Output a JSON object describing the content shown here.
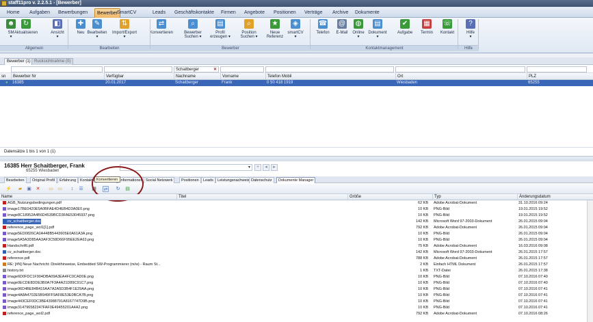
{
  "window": {
    "title": "staff11pro v. 2.2.5.1 - [Bewerber]"
  },
  "menu": {
    "tabs": [
      "Home",
      "Aufgaben",
      "Bewerbungen",
      "Bewerber",
      "SmartCV",
      "Leads",
      "Geschäftskontakte",
      "Firmen",
      "Angebote",
      "Positionen",
      "Verträge",
      "Archive",
      "Dokumente"
    ],
    "active": "Bewerber"
  },
  "ribbon": {
    "buttons": [
      {
        "label": "SM\n▾",
        "icon": "person-icon",
        "color": "#3c8a3c"
      },
      {
        "label": "Aktualisieren",
        "icon": "refresh-icon",
        "color": "#3a9a3a"
      },
      {
        "label": "Ansicht\n▾",
        "icon": "view-icon",
        "color": "#5a6fb4"
      },
      {
        "label": "Neu",
        "icon": "new-person-icon",
        "color": "#4c8fd0"
      },
      {
        "label": "Bearbeiten\n▾",
        "icon": "edit-person-icon",
        "color": "#4c8fd0"
      },
      {
        "label": "Import/Export\n▾",
        "icon": "import-export-icon",
        "color": "#e0a22c"
      },
      {
        "label": "Konvertieren",
        "icon": "convert-icon",
        "color": "#4c8fd0"
      },
      {
        "label": "Bewerber\nSuchen ▾",
        "icon": "search-person-icon",
        "color": "#4c8fd0"
      },
      {
        "label": "Profil\nerzeugen ▾",
        "icon": "profile-icon",
        "color": "#4c8fd0"
      },
      {
        "label": "Position\nSuchen ▾",
        "icon": "search-position-icon",
        "color": "#e0a22c"
      },
      {
        "label": "Neue\nReferenz",
        "icon": "reference-icon",
        "color": "#3a9a3a"
      },
      {
        "label": "smartCV\n▾",
        "icon": "smartcv-icon",
        "color": "#4c8fd0"
      },
      {
        "label": "Telefon",
        "icon": "phone-icon",
        "color": "#4c8fd0"
      },
      {
        "label": "E-Mail",
        "icon": "email-icon",
        "color": "#6a7f9f"
      },
      {
        "label": "Online\n▾",
        "icon": "globe-icon",
        "color": "#3a9a3a"
      },
      {
        "label": "Dokument\n▾",
        "icon": "document-icon",
        "color": "#4c8fd0"
      },
      {
        "label": "Aufgabe",
        "icon": "task-icon",
        "color": "#3a9a3a"
      },
      {
        "label": "Termin",
        "icon": "calendar-icon",
        "color": "#c84040"
      },
      {
        "label": "Kontakt",
        "icon": "contact-icon",
        "color": "#3a9a3a"
      },
      {
        "label": "Hilfe\n▾",
        "icon": "help-icon",
        "color": "#5a6fb4"
      }
    ],
    "groups": [
      "Allgemein",
      "Bearbeiten",
      "Bewerber",
      "Kontaktmanagement",
      "Hilfe"
    ]
  },
  "upper_tabs": [
    "Bewerber (1)",
    "Rucksichtnahme (0)"
  ],
  "filter": {
    "name_value": "Schaitberger"
  },
  "grid": {
    "headers": [
      "Bewerber Nr",
      "Verfügbar",
      "Nachname",
      "Vorname",
      "Telefon Mobil",
      "Ort",
      "PLZ"
    ],
    "row": {
      "nr": "16385",
      "verfuegbar": "20.01.2017",
      "nachname": "Schaitberger",
      "vorname": "Frank",
      "telefon": "0 50 418 1919",
      "ort": "Wiesbaden",
      "plz": "65255"
    }
  },
  "status": "Datensätze 1 bis 1 von 1 (1)",
  "detail": {
    "name": "16385   Herr Schaitberger, Frank",
    "sub": "65255 Wiesbaden"
  },
  "lower_tabs": [
    "Bearbeiten",
    "Original Profil",
    "Erfahrung",
    "Kontakte",
    "Aktivitäten",
    "Informationen",
    "Social Netzwerk",
    "Positionen",
    "Leads",
    "Leistungsnachweis",
    "Datenschutz",
    "Dokumente Manager"
  ],
  "tooltip": "Konvertieren",
  "files": {
    "headers": [
      "Name",
      "Titel",
      "Größe",
      "Typ",
      "Änderungsdatum"
    ],
    "rows": [
      {
        "name": "AGB_Nutzungsbedingungen.pdf",
        "title": "",
        "size": "62 KB",
        "type": "Adobe Acrobat-Dokument",
        "date": "31.10.2016 09:24"
      },
      {
        "name": "image17BE0420E5A0BFAE4D4EB4D3A0E0.png",
        "title": "",
        "size": "10 KB",
        "type": "PNG-Bild",
        "date": "19.01.2015 19:52"
      },
      {
        "name": "image8C18952A4B6D4539BCD3FAE53045937.png",
        "title": "",
        "size": "10 KB",
        "type": "PNG-Bild",
        "date": "19.01.2015 19:52"
      },
      {
        "name": "cv_schaitberger.doc",
        "title": "",
        "size": "142 KB",
        "type": "Microsoft Word 97-2003-Dokument",
        "date": "26.01.2015 09:04"
      },
      {
        "name": "reference_page_wol1[1].pdf",
        "title": "",
        "size": "792 KB",
        "type": "Adobe Acrobat-Dokument",
        "date": "26.01.2015 09:04"
      },
      {
        "name": "image5ED0826CA0A448B5443605E0A61A3A.png",
        "title": "",
        "size": "10 KB",
        "type": "PNG-Bild",
        "date": "26.01.2015 09:04"
      },
      {
        "name": "image5A5A3D85AA3AF3C58D66F95EE2EA63.png",
        "title": "",
        "size": "10 KB",
        "type": "PNG-Bild",
        "date": "26.01.2015 09:04"
      },
      {
        "name": "Handschriftl.pdf",
        "title": "",
        "size": "75 KB",
        "type": "Adobe Acrobat-Dokument",
        "date": "16.03.2016 09:08"
      },
      {
        "name": "cv_schaitberger.doc",
        "title": "",
        "size": "142 KB",
        "type": "Microsoft Word 97-2003-Dokument",
        "date": "26.01.2015 17:57"
      },
      {
        "name": "reference.pdf",
        "title": "",
        "size": "788 KB",
        "type": "Adobe Acrobat-Dokument",
        "date": "26.01.2015 17:57"
      },
      {
        "name": "RE: [#N] Neue Nachricht: Direkthinweise, Embedded SW-Programmierer (m/w) - Raum St...",
        "title": "",
        "size": "2 KB",
        "type": "Einfach HTML Dokument",
        "date": "26.01.2015 17:57"
      },
      {
        "name": "history.txt",
        "title": "",
        "size": "1 KB",
        "type": "TXT-Datei",
        "date": "26.01.2015 17:38"
      },
      {
        "name": "image6D0FDC1F904DBA09A3EA4FC0CAD0E.png",
        "title": "",
        "size": "10 KB",
        "type": "PNG-Bild",
        "date": "07.10.2016 07:40"
      },
      {
        "name": "image0ECDE8DDE3B0A7F3A4A21D89C91C7.png",
        "title": "",
        "size": "10 KB",
        "type": "PNG-Bild",
        "date": "07.10.2016 07:40"
      },
      {
        "name": "image96D4BE84B415AA7A2A5D3B4F1E29AA.png",
        "title": "",
        "size": "10 KB",
        "type": "PNG-Bild",
        "date": "07.10.2016 07:41"
      },
      {
        "name": "image4A8A4702E5B949FF9AF8E53E0BCA7B.png",
        "title": "",
        "size": "10 KB",
        "type": "PNG-Bild",
        "date": "07.10.2016 07:41"
      },
      {
        "name": "image443CEF0DC3BE43988791A8167747D9B.png",
        "title": "",
        "size": "10 KB",
        "type": "PNG-Bild",
        "date": "07.10.2016 07:41"
      },
      {
        "name": "image314796582347FAF0E49455201A4A2.png",
        "title": "",
        "size": "10 KB",
        "type": "PNG-Bild",
        "date": "07.10.2016 07:41"
      },
      {
        "name": "reference_page_wol2.pdf",
        "title": "",
        "size": "792 KB",
        "type": "Adobe Acrobat-Dokument",
        "date": "07.10.2016 08:26"
      }
    ]
  }
}
